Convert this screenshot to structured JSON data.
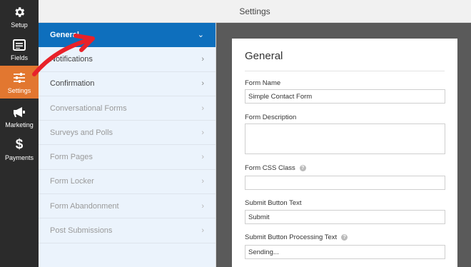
{
  "header": {
    "title": "Settings"
  },
  "sidebar": {
    "items": [
      {
        "label": "Setup",
        "icon": "gear-icon"
      },
      {
        "label": "Fields",
        "icon": "fields-icon"
      },
      {
        "label": "Settings",
        "icon": "sliders-icon",
        "active": true
      },
      {
        "label": "Marketing",
        "icon": "megaphone-icon"
      },
      {
        "label": "Payments",
        "icon": "dollar-icon"
      }
    ]
  },
  "panels": [
    {
      "label": "General",
      "active": true
    },
    {
      "label": "Notifications"
    },
    {
      "label": "Confirmation"
    },
    {
      "label": "Conversational Forms",
      "dimmed": true
    },
    {
      "label": "Surveys and Polls",
      "dimmed": true
    },
    {
      "label": "Form Pages",
      "dimmed": true
    },
    {
      "label": "Form Locker",
      "dimmed": true
    },
    {
      "label": "Form Abandonment",
      "dimmed": true
    },
    {
      "label": "Post Submissions",
      "dimmed": true
    }
  ],
  "general": {
    "title": "General",
    "form_name": {
      "label": "Form Name",
      "value": "Simple Contact Form"
    },
    "form_description": {
      "label": "Form Description",
      "value": ""
    },
    "form_css_class": {
      "label": "Form CSS Class",
      "value": ""
    },
    "submit_text": {
      "label": "Submit Button Text",
      "value": "Submit"
    },
    "submit_processing_text": {
      "label": "Submit Button Processing Text",
      "value": "Sending..."
    }
  },
  "colors": {
    "sidebar_bg": "#2b2b2b",
    "sidebar_active": "#e27730",
    "panel_active": "#0e6fbd",
    "panel_bg": "#ebf3fc",
    "annotation_arrow": "#e8222a"
  }
}
